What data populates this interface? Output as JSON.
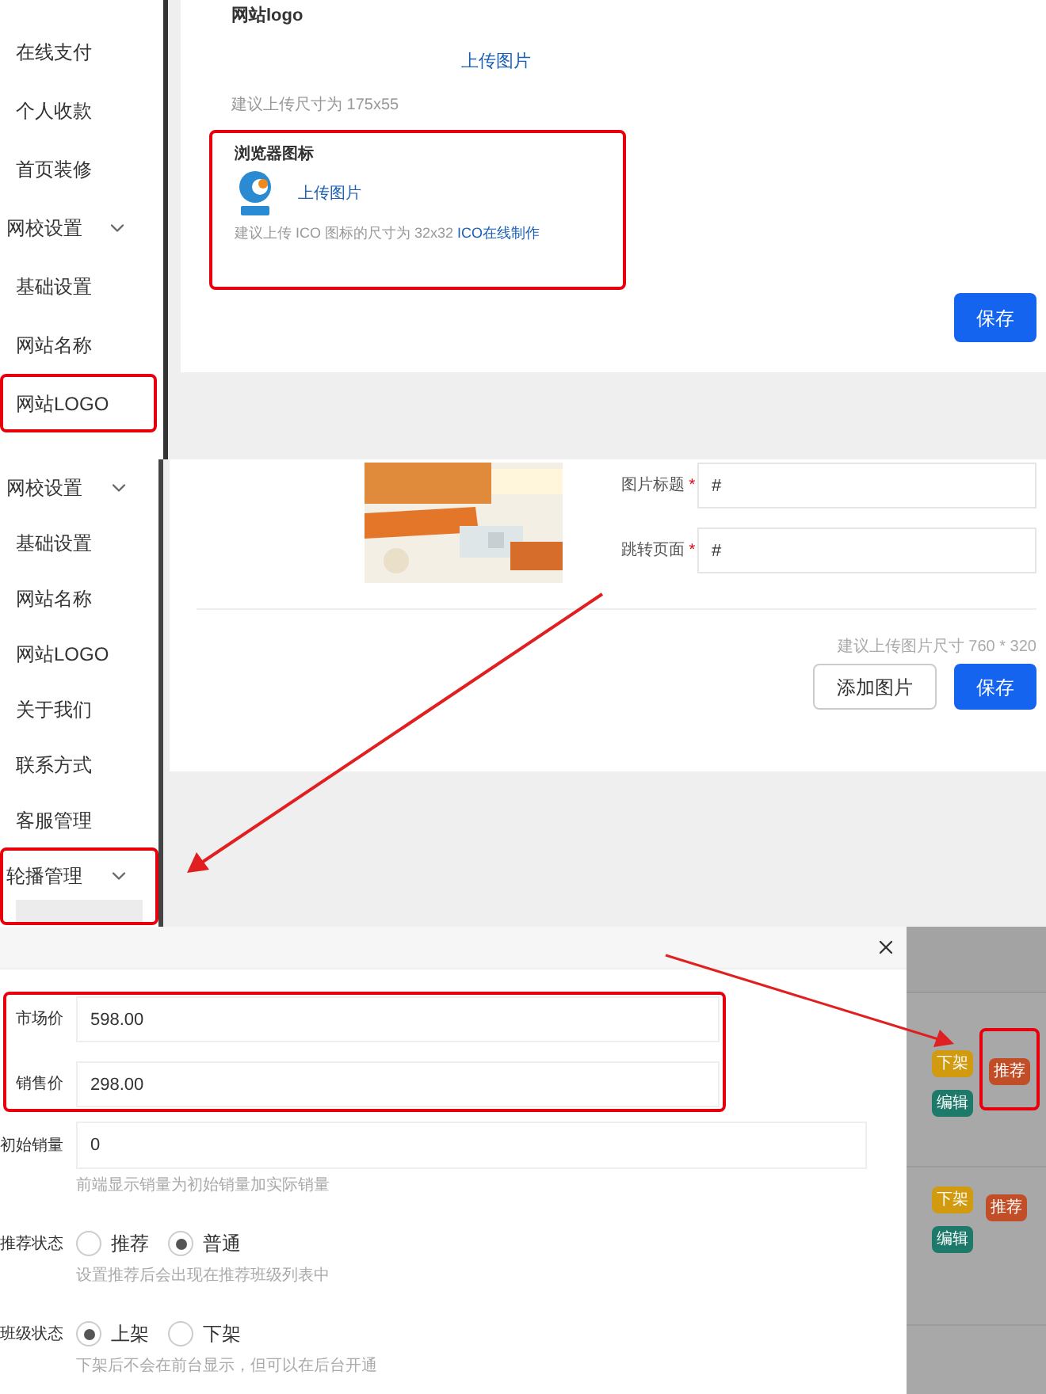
{
  "logo_panel": {
    "sidebar": [
      {
        "label": "在线支付",
        "kind": "item",
        "highlighted": false
      },
      {
        "label": "个人收款",
        "kind": "item",
        "highlighted": false
      },
      {
        "label": "首页装修",
        "kind": "item",
        "highlighted": false
      },
      {
        "label": "网校设置",
        "kind": "group",
        "expanded": true,
        "highlighted": false
      },
      {
        "label": "基础设置",
        "kind": "item",
        "highlighted": false
      },
      {
        "label": "网站名称",
        "kind": "item",
        "highlighted": false
      },
      {
        "label": "网站LOGO",
        "kind": "item",
        "highlighted": true
      }
    ],
    "logo_field": {
      "label": "网站logo",
      "upload": "上传图片",
      "hint": "建议上传尺寸为 175x55"
    },
    "favicon_field": {
      "label": "浏览器图标",
      "upload": "上传图片",
      "hint": "建议上传 ICO 图标的尺寸为 32x32",
      "link": "ICO在线制作",
      "highlighted": true
    },
    "save": "保存"
  },
  "carousel_panel": {
    "sidebar": [
      {
        "label": "网校设置",
        "kind": "group",
        "expanded": true,
        "highlighted": false
      },
      {
        "label": "基础设置",
        "kind": "item",
        "highlighted": false
      },
      {
        "label": "网站名称",
        "kind": "item",
        "highlighted": false
      },
      {
        "label": "网站LOGO",
        "kind": "item",
        "highlighted": false
      },
      {
        "label": "关于我们",
        "kind": "item",
        "highlighted": false
      },
      {
        "label": "联系方式",
        "kind": "item",
        "highlighted": false
      },
      {
        "label": "客服管理",
        "kind": "item",
        "highlighted": false
      },
      {
        "label": "轮播管理",
        "kind": "group",
        "expanded": true,
        "highlighted": true
      }
    ],
    "fields": [
      {
        "label": "图片标题",
        "required_mark": "*",
        "value": "#"
      },
      {
        "label": "跳转页面",
        "required_mark": "*",
        "value": "#"
      }
    ],
    "hint": "建议上传图片尺寸 760 * 320",
    "buttons": [
      {
        "label": "添加图片",
        "kind": "secondary"
      },
      {
        "label": "保存",
        "kind": "primary"
      }
    ]
  },
  "course_dialog": {
    "price_group": {
      "highlighted": true,
      "fields": [
        {
          "label": "市场价",
          "value": "598.00"
        },
        {
          "label": "销售价",
          "value": "298.00"
        }
      ]
    },
    "initial_sales": {
      "label": "初始销量",
      "value": "0",
      "hint": "前端显示销量为初始销量加实际销量"
    },
    "radio_groups": [
      {
        "label": "推荐状态",
        "options": [
          {
            "label": "推荐",
            "selected": false
          },
          {
            "label": "普通",
            "selected": true
          }
        ],
        "hint": "设置推荐后会出现在推荐班级列表中"
      },
      {
        "label": "班级状态",
        "options": [
          {
            "label": "上架",
            "selected": true
          },
          {
            "label": "下架",
            "selected": false
          }
        ],
        "hint": "下架后不会在前台显示，但可以在后台开通"
      }
    ]
  },
  "list_actions": [
    {
      "highlighted": true,
      "tags": [
        {
          "label": "下架",
          "color": "#d19a0f"
        },
        {
          "label": "推荐",
          "color": "#c24e28"
        },
        {
          "label": "编辑",
          "color": "#1d7a6b"
        }
      ]
    },
    {
      "highlighted": false,
      "tags": [
        {
          "label": "下架",
          "color": "#d19a0f"
        },
        {
          "label": "推荐",
          "color": "#c24e28"
        },
        {
          "label": "编辑",
          "color": "#1d7a6b"
        }
      ]
    }
  ]
}
